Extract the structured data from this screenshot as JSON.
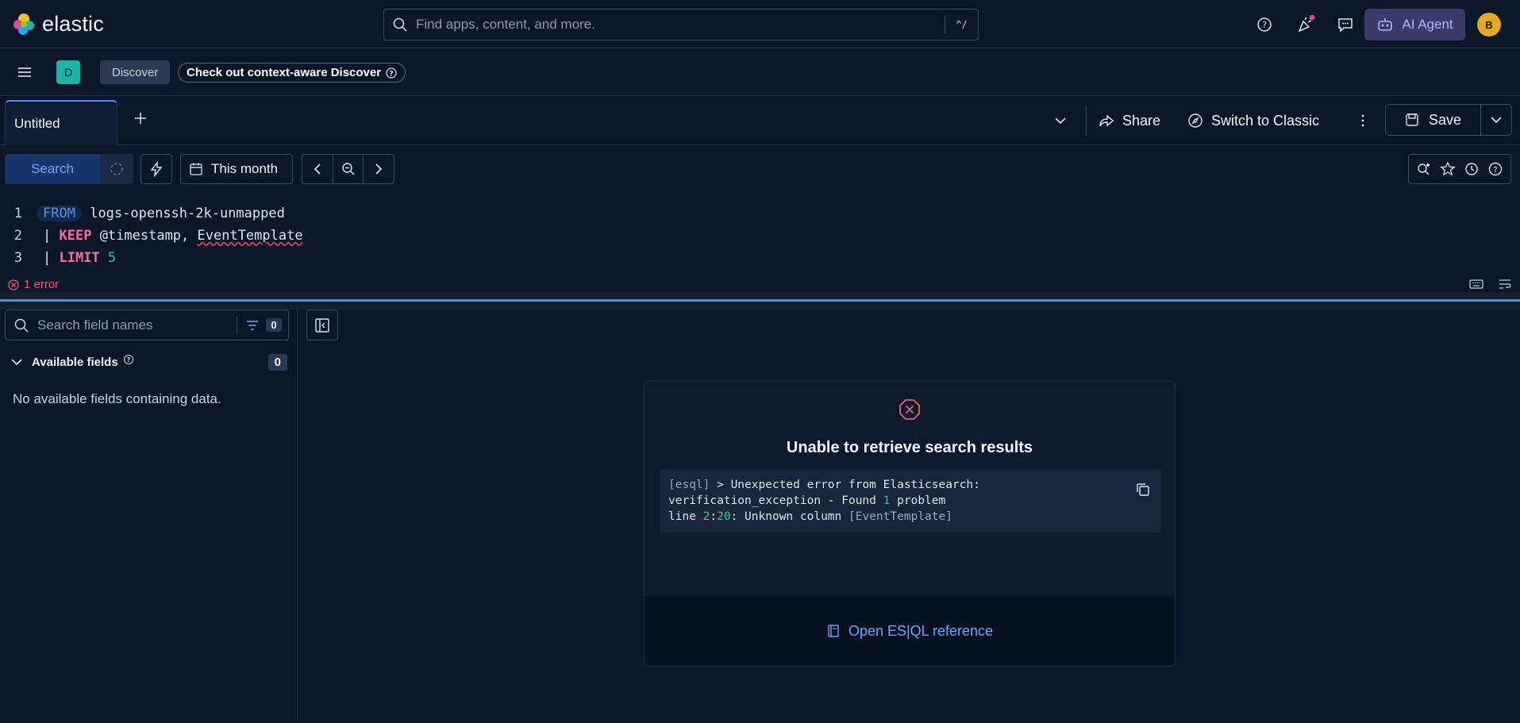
{
  "header": {
    "brand": "elastic",
    "search_placeholder": "Find apps, content, and more.",
    "search_shortcut": "^/",
    "ai_agent_label": "AI Agent",
    "avatar_initial": "B"
  },
  "breadcrumbs": {
    "space_initial": "D",
    "current": "Discover",
    "promo": "Check out context-aware Discover"
  },
  "tabs": {
    "active_label": "Untitled",
    "share_label": "Share",
    "switch_label": "Switch to Classic",
    "save_label": "Save"
  },
  "query_bar": {
    "search_label": "Search",
    "date_range": "This month"
  },
  "editor": {
    "lines": [
      {
        "number": "1",
        "keyword": "FROM",
        "rest": "logs-openssh-2k-unmapped"
      },
      {
        "number": "2",
        "prefix": "| ",
        "keyword": "KEEP",
        "rest_a": "@timestamp, ",
        "rest_err": "EventTemplate"
      },
      {
        "number": "3",
        "prefix": "| ",
        "keyword": "LIMIT",
        "num": "5"
      }
    ],
    "error_status": "1 error"
  },
  "sidebar": {
    "search_placeholder": "Search field names",
    "filter_count": "0",
    "available_label": "Available fields",
    "available_count": "0",
    "empty_message": "No available fields containing data."
  },
  "error_panel": {
    "title": "Unable to retrieve search results",
    "line1_dim": "[esql]",
    "line1_rest": " > Unexpected error from Elasticsearch:",
    "line2_a": "verification_exception - Found ",
    "line2_num": "1",
    "line2_b": " problem",
    "line3_a": "line ",
    "line3_num1": "2",
    "line3_colon": ":",
    "line3_num2": "20",
    "line3_b": ": Unknown column ",
    "line3_c": "[EventTemplate]",
    "reference_link": "Open ES|QL reference"
  },
  "colors": {
    "background": "#0b1628",
    "accent": "#4f8ef7",
    "error": "#f0596e",
    "ai_agent_bg": "#3a3a6b"
  }
}
